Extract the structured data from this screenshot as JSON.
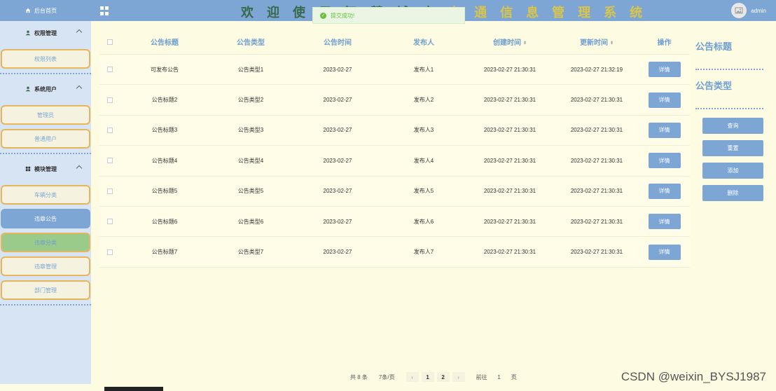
{
  "header": {
    "title_a": "欢迎使",
    "title_b": "用",
    "title_c": "交通信息管理系统",
    "title_hidden": "用",
    "username": "admin",
    "title_full_part1": "欢 迎 使",
    "title_full_part2": "用",
    "title_pre": "欢迎",
    "title_post": "交通信息管理系统"
  },
  "title": {
    "seg1": "欢 迎 ",
    "seg2": "使 用 ",
    "seg3": "智 慧 ",
    "seg4": "城 市 ",
    "seg5": "交 通 信 息 管 理 系 统"
  },
  "toast": {
    "message": "提交成功!"
  },
  "sidebar": {
    "home": "后台首页",
    "groups": [
      {
        "label": "权限管理",
        "items": [
          "权限列表"
        ]
      },
      {
        "label": "系统用户",
        "items": [
          "管理员",
          "普通用户"
        ]
      },
      {
        "label": "模块管理",
        "items": [
          "车辆分类",
          "违章公告",
          "违章分类",
          "违章管理",
          "部门管理"
        ]
      }
    ]
  },
  "table": {
    "headers": [
      "公告标题",
      "公告类型",
      "公告时间",
      "发布人",
      "创建时间",
      "更新时间",
      "操作"
    ],
    "rows": [
      [
        "可发布公告",
        "公告类型1",
        "2023-02-27",
        "发布人1",
        "2023-02-27 21:30:31",
        "2023-02-27 21:32:19",
        "详情"
      ],
      [
        "公告标题2",
        "公告类型2",
        "2023-02-27",
        "发布人2",
        "2023-02-27 21:30:31",
        "2023-02-27 21:30:31",
        "详情"
      ],
      [
        "公告标题3",
        "公告类型3",
        "2023-02-27",
        "发布人3",
        "2023-02-27 21:30:31",
        "2023-02-27 21:30:31",
        "详情"
      ],
      [
        "公告标题4",
        "公告类型4",
        "2023-02-27",
        "发布人4",
        "2023-02-27 21:30:31",
        "2023-02-27 21:30:31",
        "详情"
      ],
      [
        "公告标题5",
        "公告类型5",
        "2023-02-27",
        "发布人5",
        "2023-02-27 21:30:31",
        "2023-02-27 21:30:31",
        "详情"
      ],
      [
        "公告标题6",
        "公告类型6",
        "2023-02-27",
        "发布人6",
        "2023-02-27 21:30:31",
        "2023-02-27 21:30:31",
        "详情"
      ],
      [
        "公告标题7",
        "公告类型7",
        "2023-02-27",
        "发布人7",
        "2023-02-27 21:30:31",
        "2023-02-27 21:30:31",
        "详情"
      ]
    ]
  },
  "search": {
    "field1_label": "公告标题",
    "field2_label": "公告类型",
    "query": "查询",
    "reset": "重置",
    "add": "添加",
    "delete": "删除"
  },
  "pager": {
    "total": "共 8 条",
    "size": "7条/页",
    "pages": [
      "1",
      "2"
    ],
    "goto": "前往",
    "goto_value": "1",
    "page_unit": "页"
  },
  "watermark": "CSDN @weixin_BYSJ1987",
  "colors": {
    "accent": "#7ea6d4",
    "background": "#fdfbe2",
    "title_green": "#37694c",
    "title_yellow": "#d9c54a",
    "menu_border": "#e8b65a"
  }
}
